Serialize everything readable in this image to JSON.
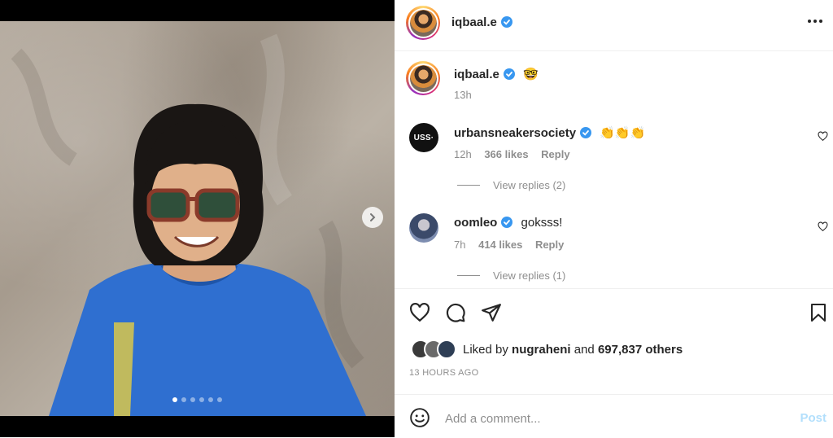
{
  "post": {
    "author": "iqbaal.e",
    "menu_icon": "more-horizontal-icon",
    "carousel": {
      "slide_count": 6,
      "active_index": 0
    }
  },
  "caption": {
    "username": "iqbaal.e",
    "emoji": "🤓",
    "time": "13h"
  },
  "comments": [
    {
      "username": "urbansneakersociety",
      "avatar_text": "USS·",
      "text": "👏👏👏",
      "time": "12h",
      "likes": "366 likes",
      "reply_label": "Reply",
      "view_replies": "View replies (2)"
    },
    {
      "username": "oomleo",
      "text": "goksss!",
      "time": "7h",
      "likes": "414 likes",
      "reply_label": "Reply",
      "view_replies": "View replies (1)"
    }
  ],
  "liked_by": {
    "prefix": "Liked by",
    "user": "nugraheni",
    "conj": "and",
    "others": "697,837 others"
  },
  "timestamp": "13 HOURS AGO",
  "add_comment": {
    "placeholder": "Add a comment...",
    "post_label": "Post"
  },
  "colors": {
    "verified": "#3897f0",
    "post_disabled": "#b2dffc",
    "muted": "#8e8e8e"
  }
}
